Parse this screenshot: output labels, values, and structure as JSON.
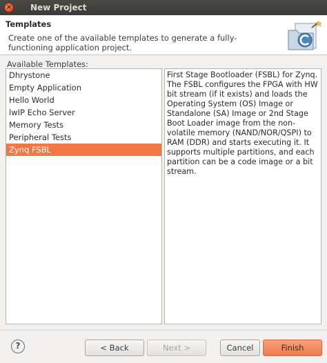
{
  "window": {
    "title": "New Project",
    "close_symbol": "×"
  },
  "header": {
    "title": "Templates",
    "description": "Create one of the available templates to generate a fully-functioning application project.",
    "icon": "new-project-wizard-icon"
  },
  "templates": {
    "label": "Available Templates:",
    "items": [
      {
        "label": "Dhrystone"
      },
      {
        "label": "Empty Application"
      },
      {
        "label": "Hello World"
      },
      {
        "label": "lwIP Echo Server"
      },
      {
        "label": "Memory Tests"
      },
      {
        "label": "Peripheral Tests"
      },
      {
        "label": "Zynq FSBL"
      }
    ],
    "selected_index": 6
  },
  "description": {
    "text": "First Stage Bootloader (FSBL) for Zynq. The FSBL configures the FPGA with HW bit stream (if it exists)  and loads the Operating System (OS) Image or Standalone (SA) Image or 2nd Stage Boot Loader image from the  non-volatile memory (NAND/NOR/QSPI) to RAM (DDR) and starts executing it.  It supports multiple partitions,  and each partition can be a code image or a bit stream."
  },
  "footer": {
    "help_symbol": "?",
    "back_label": "< Back",
    "next_label": "Next >",
    "cancel_label": "Cancel",
    "finish_label": "Finish"
  },
  "colors": {
    "selection": "#f07746",
    "titlebar": "#3c3b37",
    "finish_button": "#ee7a4c"
  }
}
